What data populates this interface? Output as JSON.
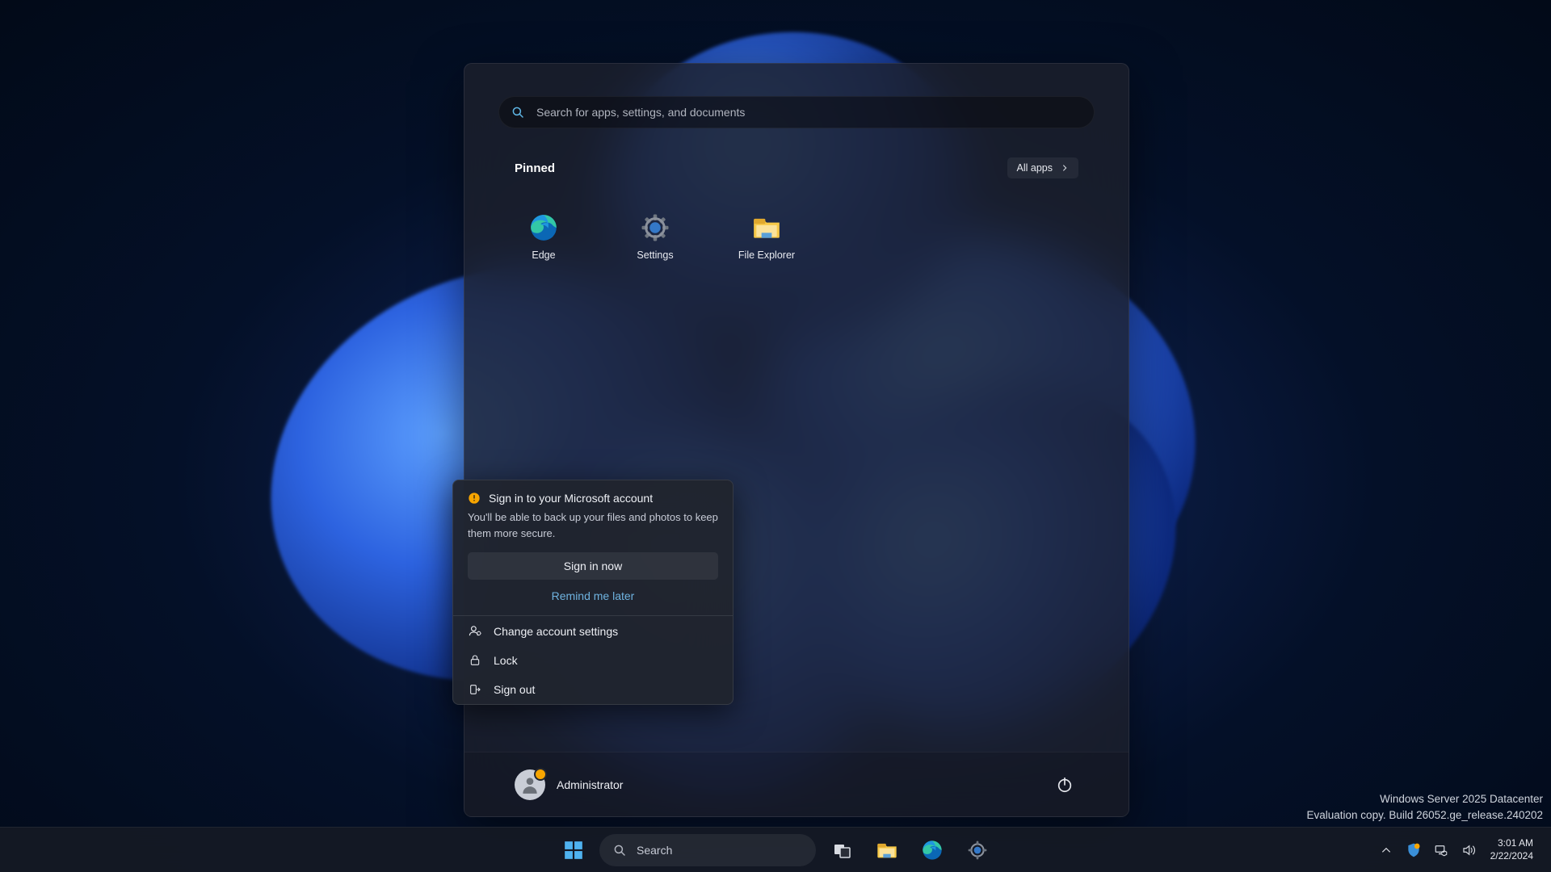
{
  "search": {
    "placeholder": "Search for apps, settings, and documents"
  },
  "pinned": {
    "title": "Pinned",
    "all_apps": "All apps",
    "apps": [
      {
        "label": "Edge"
      },
      {
        "label": "Settings"
      },
      {
        "label": "File Explorer"
      }
    ]
  },
  "user": {
    "name": "Administrator"
  },
  "flyout": {
    "title": "Sign in to your Microsoft account",
    "body": "You'll be able to back up your files and photos to keep them more secure.",
    "primary": "Sign in now",
    "secondary": "Remind me later",
    "items": [
      {
        "label": "Change account settings"
      },
      {
        "label": "Lock"
      },
      {
        "label": "Sign out"
      }
    ]
  },
  "taskbar": {
    "search": "Search"
  },
  "tray": {
    "time": "3:01 AM",
    "date": "2/22/2024"
  },
  "watermark": {
    "line1": "Windows Server 2025 Datacenter",
    "line2": "Evaluation copy. Build 26052.ge_release.240202"
  }
}
